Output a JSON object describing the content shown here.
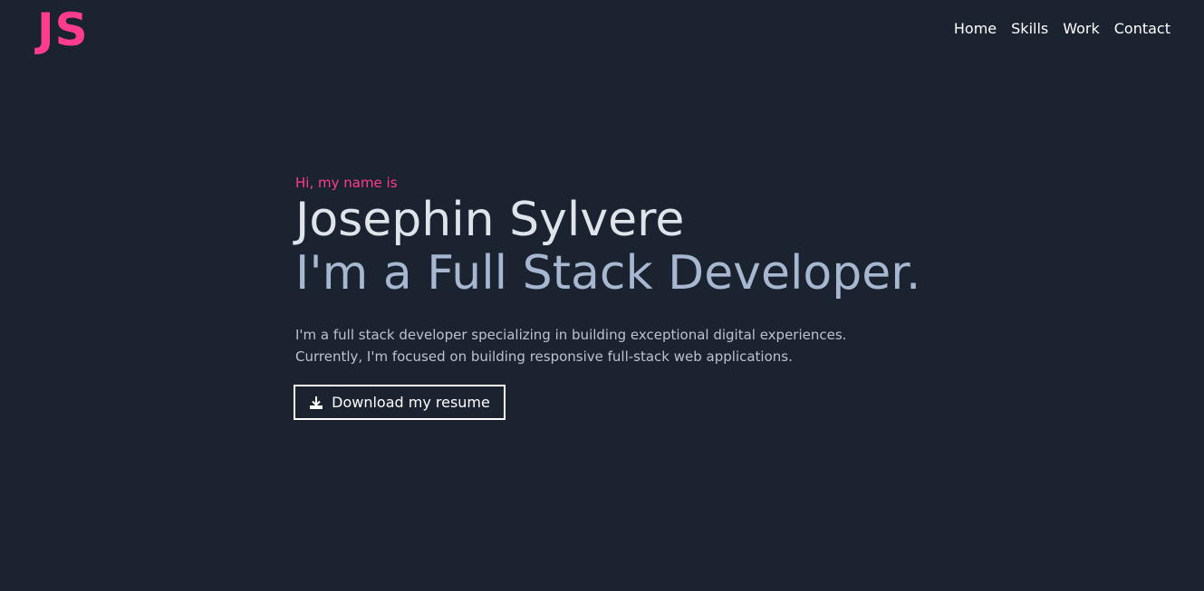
{
  "header": {
    "logo": "JS",
    "nav": [
      {
        "label": "Home"
      },
      {
        "label": "Skills"
      },
      {
        "label": "Work"
      },
      {
        "label": "Contact"
      }
    ]
  },
  "hero": {
    "intro": "Hi, my name is",
    "name": "Josephin Sylvere",
    "role": "I'm a Full Stack Developer.",
    "description": [
      "I'm a full stack developer specializing in building exceptional digital experiences.",
      "Currently, I'm focused on building responsive full-stack web applications."
    ],
    "resume_button": {
      "label": "Download my resume",
      "icon": "download-icon"
    }
  },
  "colors": {
    "background": "#1b2230",
    "accent": "#ff3c8e",
    "name_text": "#dfe3ea",
    "role_text": "#a6b7cf",
    "body_text": "#bcc3cf"
  }
}
